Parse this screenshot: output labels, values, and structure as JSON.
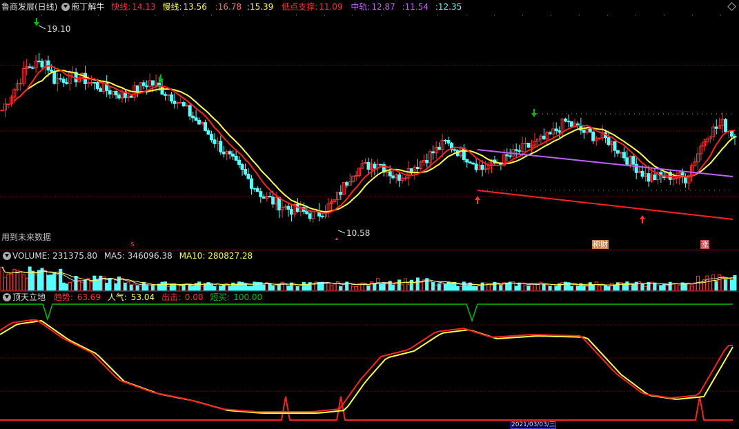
{
  "main_header": {
    "stock": "鲁商发展(日线)",
    "indicator": "庖丁解牛",
    "fast_label": "快线:",
    "fast_value": "14.13",
    "slow_label": "慢线:",
    "slow_value": "13.56",
    "v3": ":16.78",
    "v4": ":15.39",
    "support_label": "低点支撑:",
    "support_value": "11.09",
    "mid_label": "中轨:",
    "mid_value": "12.87",
    "v6": ":11.54",
    "v7": ":12.35"
  },
  "main_chart": {
    "high_label": "19.10",
    "low_label": "10.58",
    "future_label": "用到未来数据",
    "mark_s": "s",
    "mark_finance": "称财",
    "mark_rise": "涨"
  },
  "volume_header": {
    "label": "VOLUME: 231375.80",
    "ma5": "MA5: 346096.38",
    "ma10": "MA10: 280827.28"
  },
  "bottom_header": {
    "name": "顶天立地",
    "trend_label": "趋势: ",
    "trend_value": "63.69",
    "pop_label": "人气: ",
    "pop_value": "53.04",
    "out_label": "出击: ",
    "out_value": "0.00",
    "short_label": "短买: ",
    "short_value": "100.00"
  },
  "bottom_axis": {
    "date_label": "2021/03/03/三"
  },
  "colors": {
    "up": "#ff3232",
    "down": "#54ffff",
    "fast": "#ff2020",
    "slow": "#ffff40",
    "mid": "#c060ff",
    "grid": "#8b0000",
    "green": "#00c000"
  },
  "chart_data": [
    {
      "type": "candlestick",
      "title": "鲁商发展(日线)",
      "high_marker": 19.1,
      "low_marker": 10.58,
      "series": [
        {
          "name": "快线",
          "last": 14.13
        },
        {
          "name": "慢线",
          "last": 13.56
        },
        {
          "name": "低点支撑",
          "last": 11.09
        },
        {
          "name": "中轨",
          "last": 12.87
        }
      ]
    },
    {
      "type": "bar",
      "title": "VOLUME",
      "last": 231375.8,
      "ma5": 346096.38,
      "ma10": 280827.28
    },
    {
      "type": "line",
      "title": "顶天立地",
      "series": [
        {
          "name": "趋势",
          "last": 63.69
        },
        {
          "name": "人气",
          "last": 53.04
        },
        {
          "name": "出击",
          "last": 0.0
        },
        {
          "name": "短买",
          "last": 100.0
        }
      ]
    }
  ]
}
